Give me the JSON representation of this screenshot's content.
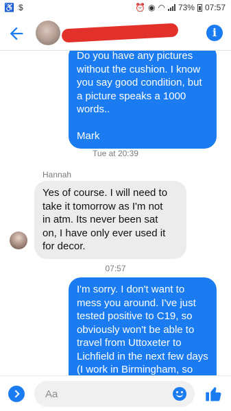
{
  "status_bar": {
    "left_icons": [
      "accessibility-icon",
      "dollar-icon"
    ],
    "right_icons": [
      "alarm-icon",
      "nfc-icon",
      "wifi-icon",
      "signal-icon",
      "battery-icon"
    ],
    "battery": "73%",
    "time": "07:57"
  },
  "header": {
    "back_icon": "back-arrow-icon",
    "info_icon": "info-icon",
    "info_glyph": "i"
  },
  "messages": [
    {
      "direction": "outgoing",
      "text": "Do you have any pictures\nwithout the cushion. I know\nyou say good condition, but\na picture speaks a 1000\nwords..\n\nMark"
    },
    {
      "type": "timestamp",
      "text": "Tue at 20:39"
    },
    {
      "type": "sender",
      "text": "Hannah"
    },
    {
      "direction": "incoming",
      "text": "Yes of course. I will need to\ntake it tomorrow as I'm not\nin atm. Its never been sat\non, I have only ever used it\nfor decor."
    },
    {
      "type": "timestamp",
      "text": "07:57"
    },
    {
      "direction": "outgoing",
      "text": "I'm sorry. I don't want to\nmess you around. I've just\ntested positive to C19, so\nobviously won't be able to\ntravel from Uttoxeter to\nLichfield in the next few days\n(I work in Birmingham, so\nI ..."
    }
  ],
  "composer": {
    "placeholder": "Aa",
    "like_icon": "thumbs-up-icon",
    "emoji_icon": "emoji-icon"
  },
  "colors": {
    "accent": "#1a7cf0",
    "incoming_bubble": "#ececec",
    "redaction": "#e2312b"
  }
}
